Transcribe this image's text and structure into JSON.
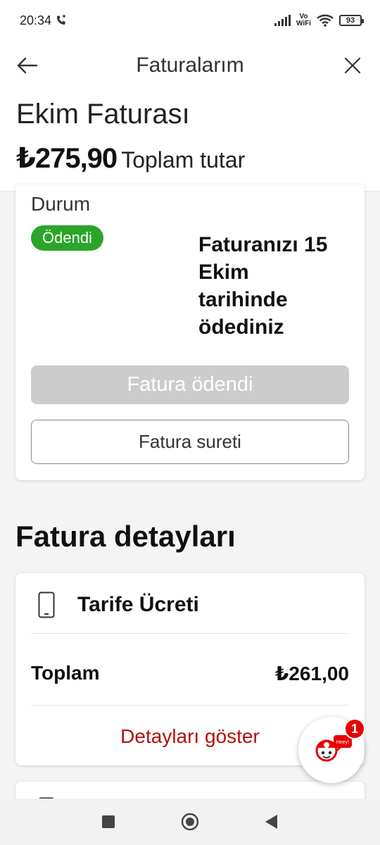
{
  "status_bar": {
    "time": "20:34",
    "vowifi_top": "Vo",
    "vowifi_bottom": "WiFi",
    "battery": "93"
  },
  "app_bar": {
    "title": "Faturalarım"
  },
  "bill": {
    "month_title": "Ekim Faturası",
    "amount": "₺275,90",
    "amount_label": "Toplam tutar"
  },
  "status_card": {
    "label": "Durum",
    "badge": "Ödendi",
    "message": "Faturanızı 15 Ekim tarihinde ödediniz",
    "paid_button": "Fatura ödendi",
    "copy_button": "Fatura sureti"
  },
  "details": {
    "section_title": "Fatura detayları",
    "tariff_title": "Tarife Ücreti",
    "total_label": "Toplam",
    "total_value": "₺261,00",
    "show_details": "Detayları göster"
  },
  "chat": {
    "badge_count": "1",
    "mascot_text": "Heey!"
  },
  "colors": {
    "accent_red": "#e60000",
    "link_red": "#b01010",
    "paid_green": "#2aa52a",
    "disabled_gray": "#cccccc"
  },
  "icons": {
    "back": "arrow-left-icon",
    "close": "close-icon",
    "phone": "smartphone-icon",
    "call": "phone-call-icon",
    "wifi": "wifi-icon",
    "nav_recent": "square-icon",
    "nav_home": "circle-icon",
    "nav_back": "triangle-back-icon"
  }
}
